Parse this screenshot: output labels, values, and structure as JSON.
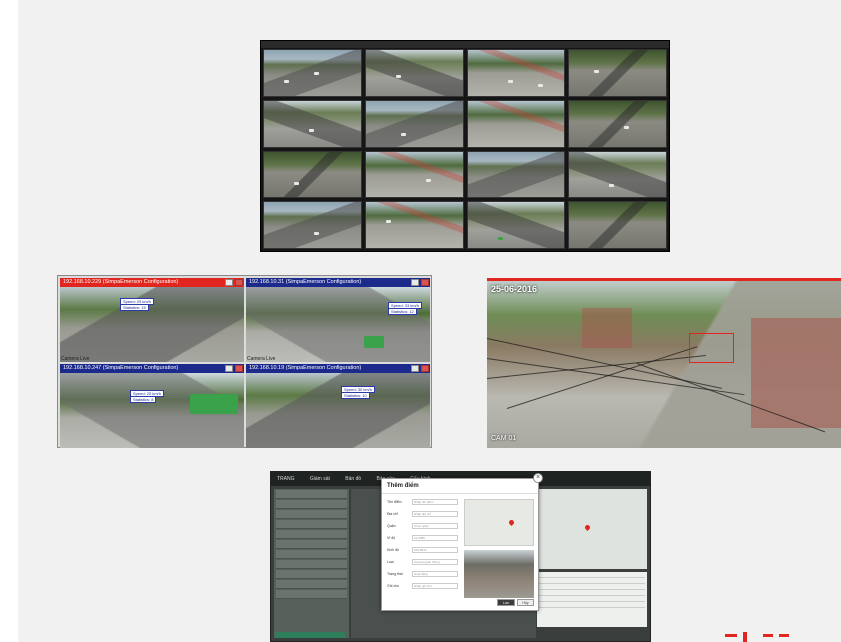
{
  "wall": {
    "title": "",
    "cam_count": 16
  },
  "quad": {
    "windows": [
      {
        "title": "192.168.10.229 (SimpaEmerson Configuration)",
        "bar": "red",
        "label1": "Speed: 29 km/h",
        "label2": "Statistics: 15"
      },
      {
        "title": "192.168.10.31 (SimpaEmerson Configuration)",
        "bar": "blue",
        "label1": "Speed: 33 km/h",
        "label2": "Statistics: 12"
      },
      {
        "title": "192.168.10.247 (SimpaEmerson Configuration)",
        "bar": "blue",
        "label1": "Speed: 25 km/h",
        "label2": "Statistics: 8"
      },
      {
        "title": "192.168.10.19 (SimpaEmerson Configuration)",
        "bar": "blue",
        "label1": "Speed: 30 km/h",
        "label2": "Statistics: 10"
      }
    ],
    "caption_left": "Camera Live",
    "caption_right": "Camera Live"
  },
  "street": {
    "timestamp": "25-06-2016",
    "cam_id": "CAM 01"
  },
  "app": {
    "nav": [
      "TRANG",
      "Giám sát",
      "Bản đồ",
      "Báo cáo",
      "Cấu hình"
    ],
    "dialog": {
      "title": "Thêm điểm",
      "fields": [
        {
          "label": "Tên điểm",
          "placeholder": "Nhập tên điểm"
        },
        {
          "label": "Địa chỉ",
          "placeholder": "Nhập địa chỉ"
        },
        {
          "label": "Quận",
          "placeholder": "Chọn quận"
        },
        {
          "label": "Vĩ độ",
          "placeholder": "21.0285"
        },
        {
          "label": "Kinh độ",
          "placeholder": "105.8542"
        },
        {
          "label": "Loại",
          "placeholder": "Camera giao thông"
        },
        {
          "label": "Trạng thái",
          "placeholder": "Hoạt động"
        },
        {
          "label": "Ghi chú",
          "placeholder": "Nhập ghi chú"
        }
      ],
      "save": "Lưu",
      "cancel": "Hủy"
    }
  },
  "colors": {
    "accent_red": "#e0261e",
    "bar_blue": "#1c2a8c",
    "app_green": "#2e7d5b"
  }
}
